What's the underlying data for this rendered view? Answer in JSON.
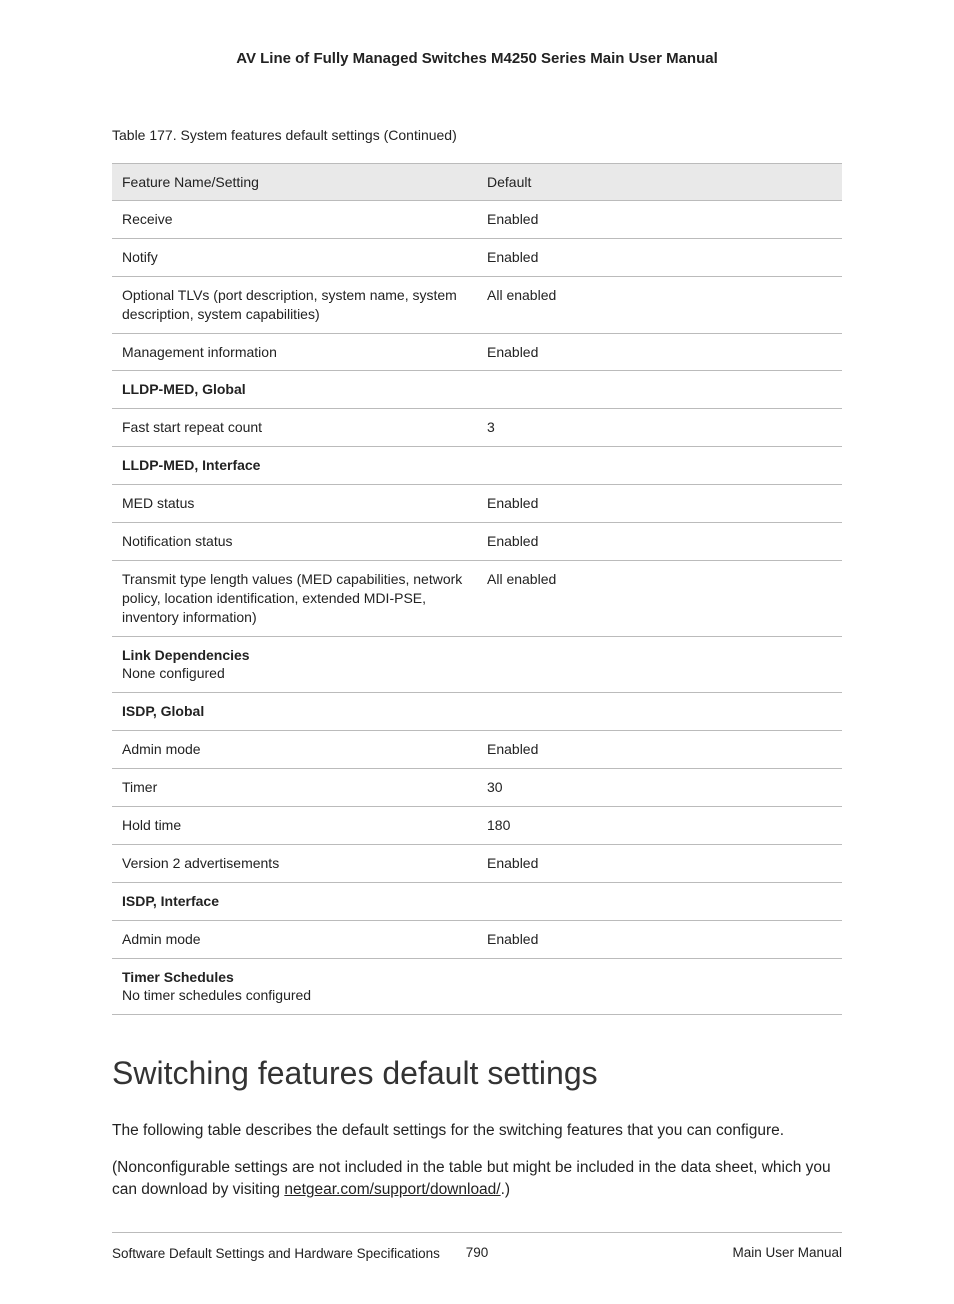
{
  "header": {
    "title": "AV Line of Fully Managed Switches M4250 Series Main User Manual"
  },
  "table": {
    "caption": "Table 177. System features default settings (Continued)",
    "head": {
      "col1": "Feature Name/Setting",
      "col2": "Default"
    },
    "rows": [
      {
        "type": "data",
        "name": "Receive",
        "default": "Enabled"
      },
      {
        "type": "data",
        "name": "Notify",
        "default": "Enabled"
      },
      {
        "type": "data",
        "name": "Optional TLVs (port description, system name, system description, system capabilities)",
        "default": "All enabled"
      },
      {
        "type": "data",
        "name": "Management information",
        "default": "Enabled"
      },
      {
        "type": "section",
        "name": "LLDP-MED, Global",
        "sub": ""
      },
      {
        "type": "data",
        "name": "Fast start repeat count",
        "default": "3"
      },
      {
        "type": "section",
        "name": "LLDP-MED, Interface",
        "sub": ""
      },
      {
        "type": "data",
        "name": "MED status",
        "default": "Enabled"
      },
      {
        "type": "data",
        "name": "Notification status",
        "default": "Enabled"
      },
      {
        "type": "data",
        "name": "Transmit type length values (MED capabilities, network policy, location identification, extended MDI-PSE, inventory information)",
        "default": "All enabled"
      },
      {
        "type": "section",
        "name": "Link Dependencies",
        "sub": "None configured"
      },
      {
        "type": "section",
        "name": "ISDP, Global",
        "sub": ""
      },
      {
        "type": "data",
        "name": "Admin mode",
        "default": "Enabled"
      },
      {
        "type": "data",
        "name": "Timer",
        "default": "30"
      },
      {
        "type": "data",
        "name": "Hold time",
        "default": "180"
      },
      {
        "type": "data",
        "name": "Version 2 advertisements",
        "default": "Enabled"
      },
      {
        "type": "section",
        "name": "ISDP, Interface",
        "sub": ""
      },
      {
        "type": "data",
        "name": "Admin mode",
        "default": "Enabled"
      },
      {
        "type": "section",
        "name": "Timer Schedules",
        "sub": "No timer schedules configured"
      }
    ]
  },
  "sectionHeading": "Switching features default settings",
  "para1": "The following table describes the default settings for the switching features that you can configure.",
  "para2_pre": "(Nonconfigurable settings are not included in the table but might be included in the data sheet, which you can download by visiting ",
  "para2_link": "netgear.com/support/download/",
  "para2_post": ".)",
  "footer": {
    "left": "Software Default Settings and Hardware Specifications",
    "center": "790",
    "right": "Main User Manual"
  }
}
